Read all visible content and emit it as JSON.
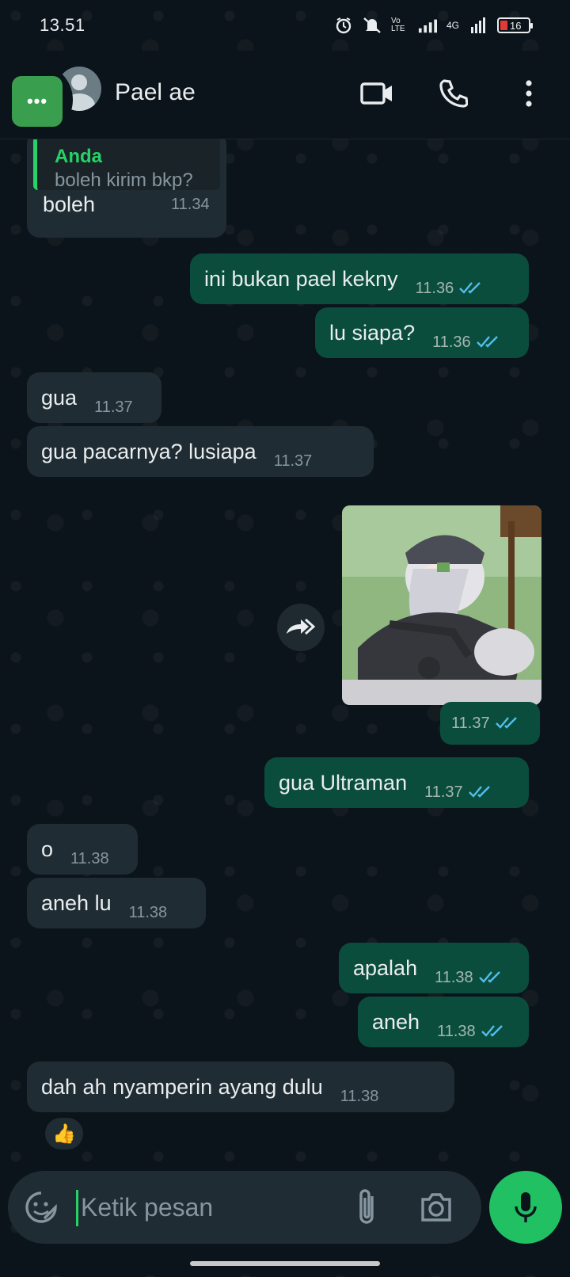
{
  "status_bar": {
    "time": "13.51",
    "network_label": "4G",
    "volte_label": "Vo LTE",
    "battery_level": "16"
  },
  "header": {
    "menu_label": "•••",
    "contact_name": "Pael ae",
    "actions": [
      "video-call-icon",
      "voice-call-icon",
      "more-options-icon"
    ]
  },
  "messages": [
    {
      "dir": "in",
      "quoted_name": "Anda",
      "quoted_text": "boleh kirim bkp?",
      "text": "boleh",
      "time": "11.34"
    },
    {
      "dir": "out",
      "text": "ini bukan pael kekny",
      "time": "11.36",
      "read": true
    },
    {
      "dir": "out",
      "text": "lu siapa?",
      "time": "11.36",
      "read": true
    },
    {
      "dir": "in",
      "text": "gua",
      "time": "11.37"
    },
    {
      "dir": "in",
      "text": "gua pacarnya? lusiapa",
      "time": "11.37"
    },
    {
      "dir": "out",
      "type": "image",
      "time": "11.37",
      "read": true
    },
    {
      "dir": "out",
      "text": "gua Ultraman",
      "time": "11.37",
      "read": true
    },
    {
      "dir": "in",
      "text": "o",
      "time": "11.38"
    },
    {
      "dir": "in",
      "text": "aneh lu",
      "time": "11.38"
    },
    {
      "dir": "out",
      "text": "apalah",
      "time": "11.38",
      "read": true
    },
    {
      "dir": "out",
      "text": "aneh",
      "time": "11.38",
      "read": true
    },
    {
      "dir": "in",
      "text": "dah ah nyamperin ayang dulu",
      "time": "11.38",
      "reaction": "👍"
    }
  ],
  "input": {
    "placeholder": "Ketik pesan"
  },
  "colors": {
    "background": "#0b141a",
    "incoming_bubble": "#202c33",
    "outgoing_bubble": "#0b4d3c",
    "accent_green": "#21c063",
    "read_ticks": "#53bdeb"
  }
}
